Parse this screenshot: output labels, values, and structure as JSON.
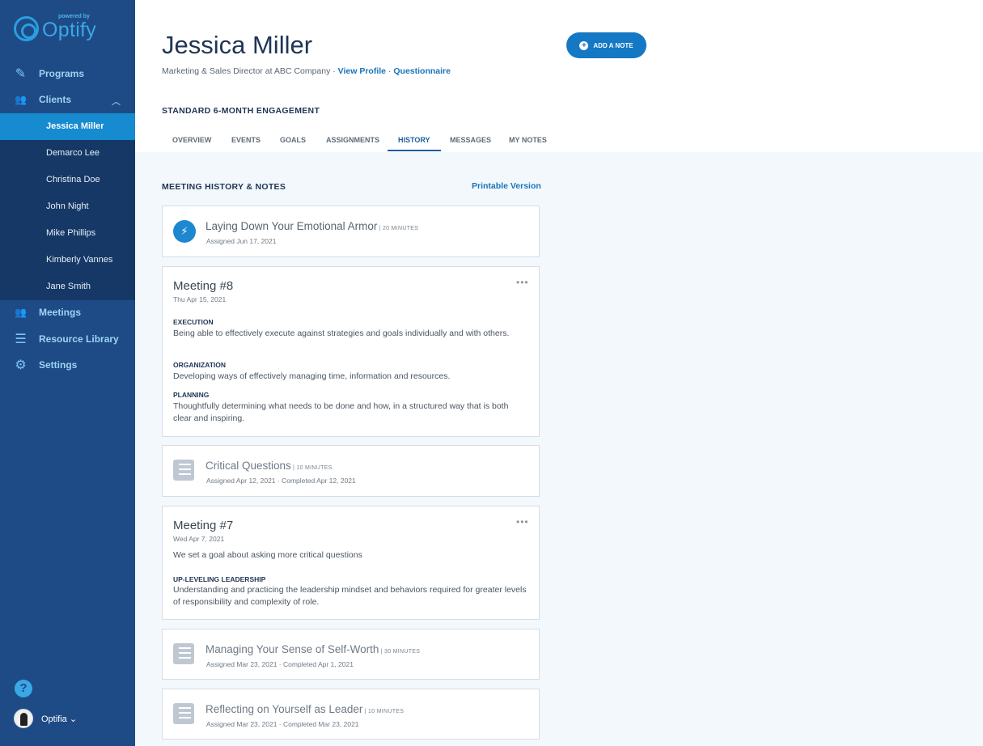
{
  "logo": {
    "powered_by": "powered by",
    "name": "Optify"
  },
  "sidebar": {
    "programs": "Programs",
    "clients": "Clients",
    "client_list": [
      "Jessica Miller",
      "Demarco Lee",
      "Christina Doe",
      "John Night",
      "Mike Phillips",
      "Kimberly Vannes",
      "Jane Smith"
    ],
    "meetings": "Meetings",
    "resource_library": "Resource Library",
    "settings": "Settings",
    "help": "?",
    "user_name": "Optifia ⌄"
  },
  "header": {
    "client_name": "Jessica Miller",
    "subtitle": "Marketing & Sales Director at ABC Company · ",
    "view_profile": "View Profile",
    "separator": " · ",
    "questionnaire": "Questionnaire",
    "add_note": "ADD A NOTE",
    "engagement": "STANDARD 6-MONTH ENGAGEMENT",
    "tabs": [
      "OVERVIEW",
      "EVENTS",
      "GOALS",
      "ASSIGNMENTS",
      "HISTORY",
      "MESSAGES",
      "MY NOTES"
    ],
    "active_tab": "HISTORY"
  },
  "history": {
    "section_title": "MEETING HISTORY & NOTES",
    "printable": "Printable Version",
    "items": [
      {
        "type": "assignment",
        "icon": "lightning-icon",
        "title": "Laying Down Your Emotional Armor",
        "duration": " | 20 MINUTES",
        "meta": "Assigned Jun 17, 2021"
      },
      {
        "type": "meeting",
        "title": "Meeting #8",
        "date": "Thu Apr 15, 2021",
        "sections": [
          {
            "heading": "EXECUTION",
            "text": "Being able to effectively execute against strategies and goals individually and with others."
          },
          {
            "heading": "ORGANIZATION",
            "text": "Developing ways of effectively managing time, information and resources."
          },
          {
            "heading": "PLANNING",
            "text": "Thoughtfully determining what needs to be done and how, in a structured way that is both clear and inspiring."
          }
        ]
      },
      {
        "type": "assignment",
        "icon": "list-icon",
        "title": "Critical Questions",
        "duration": " | 10 MINUTES",
        "meta": "Assigned Apr 12, 2021 · Completed Apr 12, 2021"
      },
      {
        "type": "meeting",
        "title": "Meeting #7",
        "date": "Wed Apr 7, 2021",
        "note": "We set a goal about asking more critical questions",
        "sections": [
          {
            "heading": "UP-LEVELING LEADERSHIP",
            "text": "Understanding and practicing the leadership mindset and behaviors required for greater levels of responsibility and complexity of role."
          }
        ]
      },
      {
        "type": "assignment",
        "icon": "list-icon",
        "title": "Managing Your Sense of Self-Worth",
        "duration": " | 30 MINUTES",
        "meta": "Assigned Mar 23, 2021 · Completed Apr 1, 2021"
      },
      {
        "type": "assignment",
        "icon": "list-icon",
        "title": "Reflecting on Yourself as Leader",
        "duration": " | 10 MINUTES",
        "meta": "Assigned Mar 23, 2021 · Completed Mar 23, 2021"
      }
    ]
  },
  "colors": {
    "sidebar": "#1e4b86",
    "accent": "#168bd0",
    "content_bg": "#f3f8fc"
  }
}
